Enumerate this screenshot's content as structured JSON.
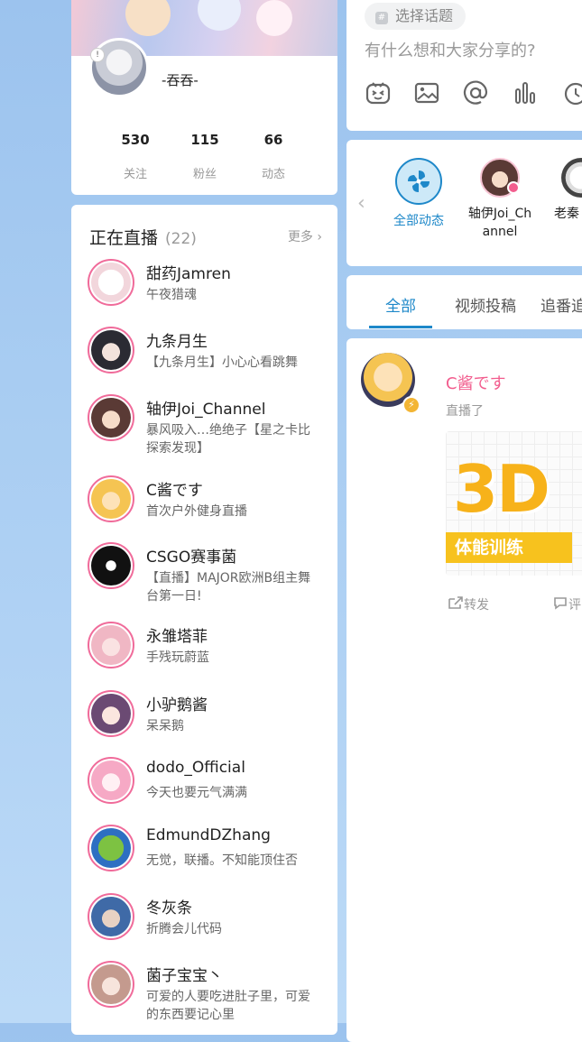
{
  "profile": {
    "name": "-吞吞-",
    "stats": [
      {
        "num": "530",
        "label": "关注"
      },
      {
        "num": "115",
        "label": "粉丝"
      },
      {
        "num": "66",
        "label": "动态"
      }
    ]
  },
  "live": {
    "title": "正在直播",
    "count": "(22)",
    "more": "更多",
    "items": [
      {
        "name": "甜药Jamren",
        "desc": "午夜猎魂"
      },
      {
        "name": "九条月生",
        "desc": "【九条月生】小心心看跳舞"
      },
      {
        "name": "轴伊Joi_Channel",
        "desc": "暴风吸入…绝绝子【星之卡比探索发现】"
      },
      {
        "name": "C酱です",
        "desc": "首次户外健身直播"
      },
      {
        "name": "CSGO赛事菌",
        "desc": "【直播】MAJOR欧洲B组主舞台第一日!"
      },
      {
        "name": "永雏塔菲",
        "desc": "手残玩蔚蓝"
      },
      {
        "name": "小驴鹅酱",
        "desc": "呆呆鹅"
      },
      {
        "name": "dodo_Official",
        "desc": "今天也要元气满满"
      },
      {
        "name": "EdmundDZhang",
        "desc": "无觉，联播。不知能顶住否"
      },
      {
        "name": "冬灰条",
        "desc": "折腾会儿代码"
      },
      {
        "name": "菌子宝宝丶",
        "desc": "可爱的人要吃进肚子里，可爱的东西要记心里"
      }
    ]
  },
  "composer": {
    "topic": "选择话题",
    "placeholder": "有什么想和大家分享的?",
    "tools": [
      "emoji-icon",
      "image-icon",
      "at-icon",
      "vote-icon",
      "schedule-icon"
    ]
  },
  "follow": {
    "items": [
      {
        "label": "全部动态"
      },
      {
        "label": "轴伊Joi_Ch annel"
      },
      {
        "label": "老秦"
      }
    ]
  },
  "tabs": [
    "全部",
    "视频投稿",
    "追番追"
  ],
  "feed": {
    "name": "C酱です",
    "action": "直播了",
    "cover_big": "3D",
    "cover_band": "体能训练",
    "repost": "转发",
    "comment": "评"
  },
  "colors": {
    "accent": "#1e88c9",
    "pink": "#f25d8e",
    "live_ring": "#f06b9a"
  }
}
